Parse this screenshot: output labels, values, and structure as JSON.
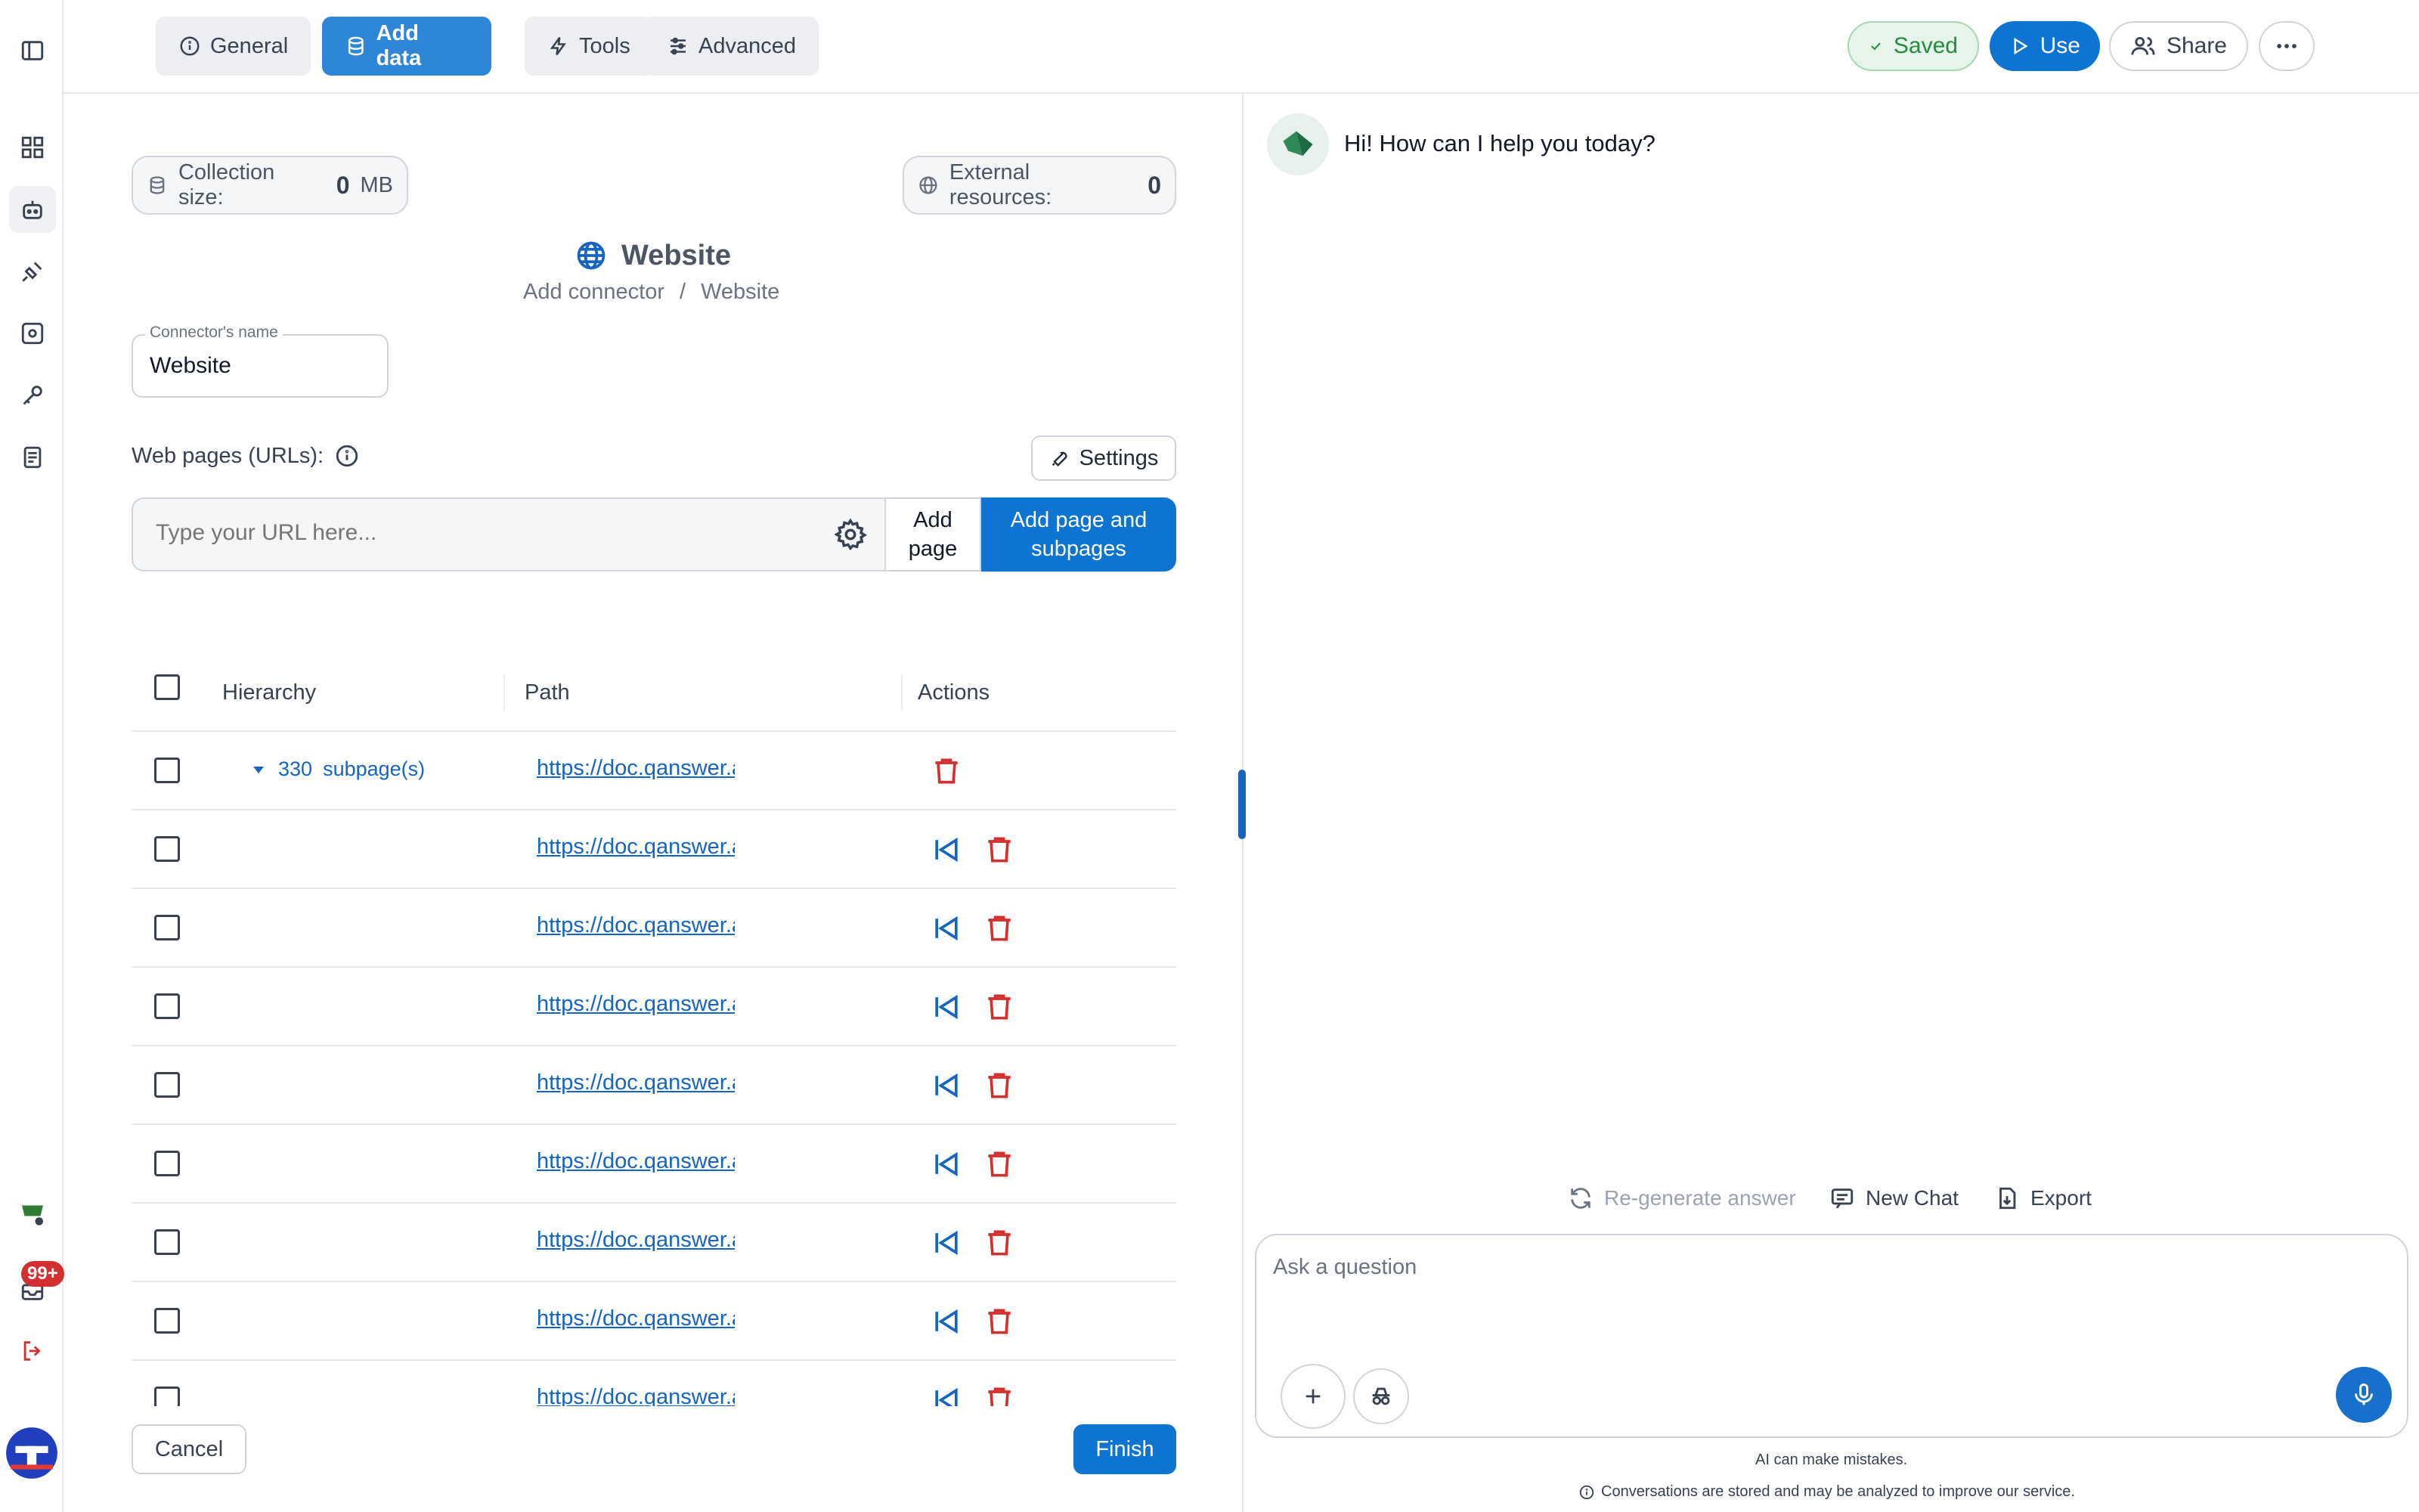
{
  "tabs": [
    {
      "label": "General",
      "icon": "info-circle-icon"
    },
    {
      "label": "Add data",
      "icon": "database-icon"
    },
    {
      "label": "Tools",
      "icon": "bolt-icon"
    },
    {
      "label": "Advanced",
      "icon": "sliders-icon"
    }
  ],
  "header_actions": {
    "saved": "Saved",
    "use": "Use",
    "share": "Share"
  },
  "rail": {
    "notification_count": "99+"
  },
  "stats": {
    "collection_label": "Collection size:",
    "collection_value": "0",
    "collection_unit": "MB",
    "external_label": "External resources:",
    "external_value": "0"
  },
  "connector": {
    "title": "Website",
    "breadcrumb": [
      "Add connector",
      "/",
      "Website"
    ],
    "name_label": "Connector's name",
    "name_value": "Website"
  },
  "web_pages": {
    "label": "Web pages (URLs):",
    "settings_label": "Settings",
    "url_placeholder": "Type your URL here...",
    "add_page_label": "Add page",
    "add_subpages_label": "Add page and subpages"
  },
  "table": {
    "columns": [
      "Hierarchy",
      "Path",
      "Actions"
    ],
    "root": {
      "count": "330",
      "label": "subpage(s)",
      "url": "https://doc.qanswer.ai/"
    },
    "rows": [
      {
        "url": "https://doc.qanswer.ai/fr/docs/ai-assistant"
      },
      {
        "url": "https://doc.qanswer.ai/fr/docs/organization"
      },
      {
        "url": "https://doc.qanswer.ai/de/docs/ai-assistant"
      },
      {
        "url": "https://doc.qanswer.ai/fr/docs/ai-assistant"
      },
      {
        "url": "https://doc.qanswer.ai/en/docs/premium"
      },
      {
        "url": "https://doc.qanswer.ai/de/docs/ai-assistant"
      },
      {
        "url": "https://doc.qanswer.ai/de/docs/ai-assistant"
      },
      {
        "url": "https://doc.qanswer.ai/en/docs/premium"
      }
    ]
  },
  "footer_buttons": {
    "cancel": "Cancel",
    "finish": "Finish"
  },
  "chat": {
    "greeting": "Hi! How can I help you today?",
    "regenerate": "Re-generate answer",
    "new_chat": "New Chat",
    "export": "Export",
    "placeholder": "Ask a question",
    "disclaimer": "AI can make mistakes.",
    "privacy": "Conversations are stored and may be analyzed to improve our service."
  },
  "colors": {
    "accent": "#0d74d1",
    "danger": "#d32f2f",
    "link": "#1565c0",
    "saved_green": "#1e8e3e"
  }
}
